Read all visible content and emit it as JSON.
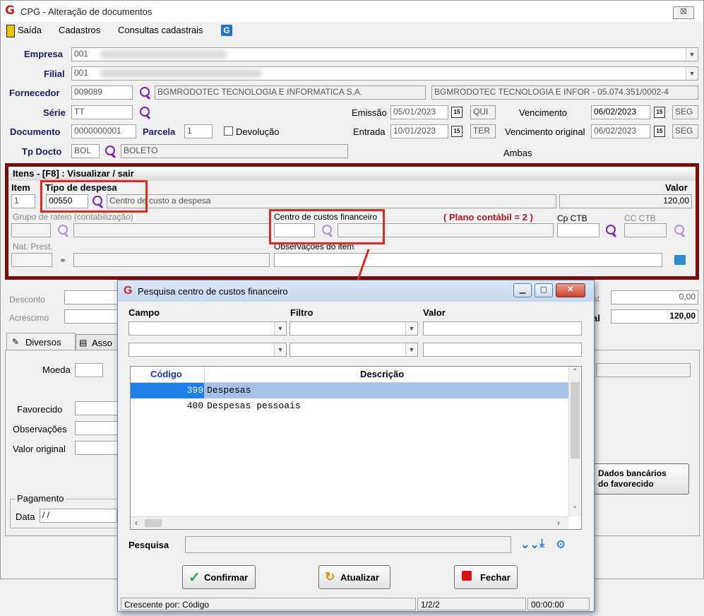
{
  "window": {
    "title": "CPG - Alteração de documentos",
    "close": "☒"
  },
  "menu": {
    "saida": "Saída",
    "cadastros": "Cadastros",
    "consultas": "Consultas cadastrais"
  },
  "form": {
    "empresa_label": "Empresa",
    "empresa_value": "001",
    "filial_label": "Filial",
    "filial_value": "001",
    "fornecedor_label": "Fornecedor",
    "fornecedor_code": "009089",
    "fornecedor_name": "BGMRODOTEC TECNOLOGIA E INFORMATICA S.A.",
    "fornecedor_full": "BGMRODOTEC TECNOLOGIA E INFOR - 05.074.351/0002-4",
    "serie_label": "Série",
    "serie_value": "TT",
    "emissao_label": "Emissão",
    "emissao_date": "05/01/2023",
    "emissao_day": "QUI",
    "vencimento_label": "Vencimento",
    "vencimento_date": "06/02/2023",
    "vencimento_day": "SEG",
    "documento_label": "Documento",
    "documento_value": "0000000001",
    "parcela_label": "Parcela",
    "parcela_value": "1",
    "devolucao_label": "Devolução",
    "entrada_label": "Entrada",
    "entrada_date": "10/01/2023",
    "entrada_day": "TER",
    "venc_original_label": "Vencimento original",
    "venc_original_date": "06/02/2023",
    "venc_original_day": "SEG",
    "tpdocto_label": "Tp Docto",
    "tpdocto_code": "BOL",
    "tpdocto_name": "BOLETO",
    "ambas": "Ambas",
    "cal": "15"
  },
  "items": {
    "header": "Itens  - [F8] : Visualizar / sair",
    "item_label": "Item",
    "item_value": "1",
    "tipo_label": "Tipo de despesa",
    "tipo_value": "00550",
    "tipo_desc": "Centro de custo a despesa",
    "valor_label": "Valor",
    "valor_value": "120,00",
    "grupo_label": "Grupo de rateio (contabilização)",
    "ccf_label": "Centro de custos financeiro",
    "plano": "( Plano contábil = 2 )",
    "cpctb_label": "Cp CTB",
    "ccctb_label": "CC CTB",
    "natprest_label": "Nat. Prest.",
    "obs_label": "Observações do item"
  },
  "totals": {
    "desconto_label": "Desconto",
    "acrescimo_label": "Acréscimo",
    "desc_val": "0,00",
    "total_val": "120,00",
    "t1": "at",
    "t2": "al"
  },
  "tabs": {
    "diversos": "Diversos",
    "assoc": "Asso",
    "moeda": "Moeda",
    "favorecido": "Favorecido",
    "observacoes": "Observações",
    "valor_original": "Valor original",
    "pagamento": "Pagamento",
    "data": "Data",
    "data_value": " / /",
    "dados_bancarios_1": "Dados bancários",
    "dados_bancarios_2": "do favorecido"
  },
  "dialog": {
    "title": "Pesquisa centro de custos financeiro",
    "campo": "Campo",
    "filtro": "Filtro",
    "valor": "Valor",
    "col_codigo": "Código",
    "col_descricao": "Descrição",
    "rows": [
      {
        "code": "399",
        "desc": "Despesas"
      },
      {
        "code": "400",
        "desc": "Despesas pessoais"
      }
    ],
    "pesquisa": "Pesquisa",
    "confirmar": "Confirmar",
    "atualizar": "Atualizar",
    "fechar": "Fechar",
    "status_sort": "Crescente por: Código",
    "status_count": "1/2/2",
    "status_time": "00:00:00"
  },
  "colors": {
    "accent_red": "#e0281e",
    "panel_border": "#7b0d0d",
    "select_blue": "#a7c0e6",
    "label_navy": "#1a1a6a"
  }
}
